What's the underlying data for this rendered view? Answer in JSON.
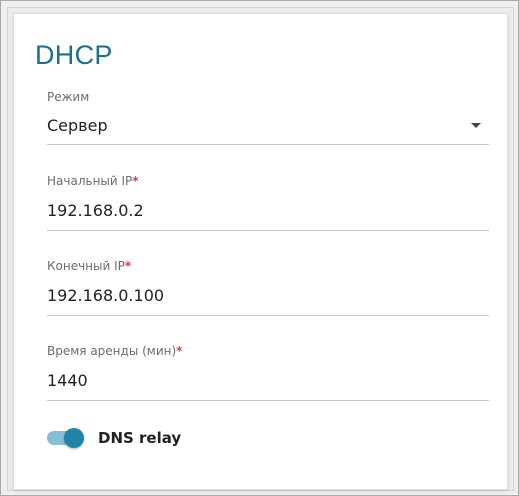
{
  "section": {
    "title": "DHCP"
  },
  "mode": {
    "label": "Режим",
    "value": "Сервер"
  },
  "start_ip": {
    "label": "Начальный IP",
    "required_mark": "*",
    "value": "192.168.0.2"
  },
  "end_ip": {
    "label": "Конечный IP",
    "required_mark": "*",
    "value": "192.168.0.100"
  },
  "lease_time": {
    "label": "Время аренды (мин)",
    "required_mark": "*",
    "value": "1440"
  },
  "dns_relay": {
    "label": "DNS relay",
    "enabled": true
  },
  "colors": {
    "accent": "#1f84a8",
    "title": "#1d6f86",
    "required": "#e03a3a"
  }
}
